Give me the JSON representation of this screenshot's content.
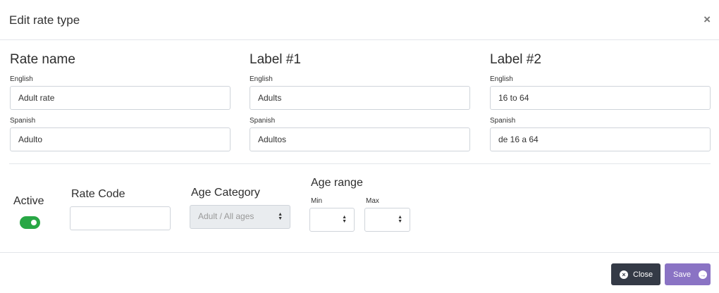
{
  "dialog": {
    "title": "Edit rate type",
    "close_glyph": "×"
  },
  "columns": [
    {
      "heading": "Rate name",
      "fields": [
        {
          "label": "English",
          "value": "Adult rate"
        },
        {
          "label": "Spanish",
          "value": "Adulto"
        }
      ]
    },
    {
      "heading": "Label #1",
      "fields": [
        {
          "label": "English",
          "value": "Adults"
        },
        {
          "label": "Spanish",
          "value": "Adultos"
        }
      ]
    },
    {
      "heading": "Label #2",
      "fields": [
        {
          "label": "English",
          "value": "16 to 64"
        },
        {
          "label": "Spanish",
          "value": "de 16 a 64"
        }
      ]
    }
  ],
  "settings": {
    "active_label": "Active",
    "active_on": true,
    "rate_code_label": "Rate Code",
    "rate_code_value": "",
    "age_category_label": "Age Category",
    "age_category_value": "Adult / All ages",
    "age_range_label": "Age range",
    "min_label": "Min",
    "min_value": "",
    "max_label": "Max",
    "max_value": ""
  },
  "footer": {
    "close_label": "Close",
    "save_label": "Save",
    "close_icon": "x-circle-icon",
    "save_icon": "arrow-right-circle-icon"
  },
  "colors": {
    "toggle_on": "#28a745",
    "close_button": "#343a46",
    "save_button": "#8a73c4"
  }
}
